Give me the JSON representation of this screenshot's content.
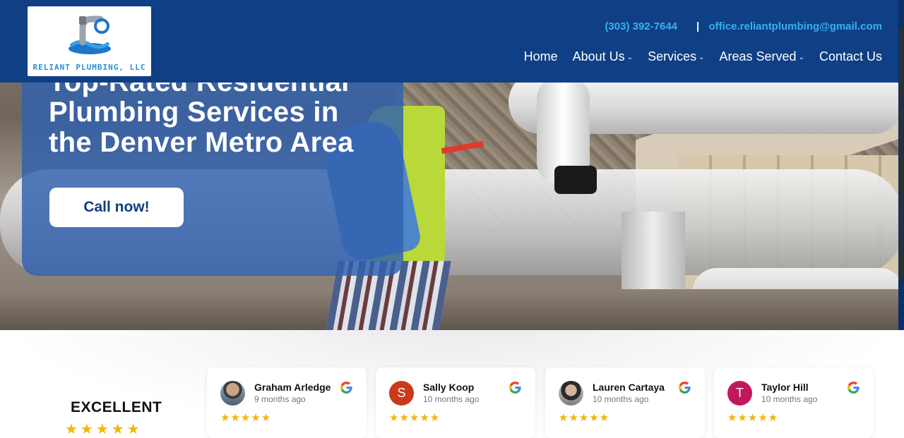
{
  "header": {
    "logo_text": "RELIANT PLUMBING, LLC",
    "phone": "(303) 392-7644",
    "divider": "|",
    "email": "office.reliantplumbing@gmail.com",
    "nav": [
      {
        "label": "Home",
        "dropdown": false
      },
      {
        "label": "About Us",
        "dropdown": true
      },
      {
        "label": "Services",
        "dropdown": true
      },
      {
        "label": "Areas Served",
        "dropdown": true
      },
      {
        "label": "Contact Us",
        "dropdown": false
      }
    ],
    "caret": "⌄"
  },
  "hero": {
    "title": "Top-Rated Residential Plumbing Services in the Denver Metro Area",
    "cta_label": "Call now!"
  },
  "reviews": {
    "summary_label": "EXCELLENT",
    "summary_stars": "★★★★★",
    "items": [
      {
        "name": "Graham Arledge",
        "time": "9 months ago",
        "stars": "★★★★★",
        "avatar": "photo",
        "initial": ""
      },
      {
        "name": "Sally Koop",
        "time": "10 months ago",
        "stars": "★★★★★",
        "avatar": "letter",
        "initial": "S",
        "avatar_color": "#c9391a"
      },
      {
        "name": "Lauren Cartaya",
        "time": "10 months ago",
        "stars": "★★★★★",
        "avatar": "photo2",
        "initial": ""
      },
      {
        "name": "Taylor Hill",
        "time": "10 months ago",
        "stars": "★★★★★",
        "avatar": "letter",
        "initial": "T",
        "avatar_color": "#c2185b"
      }
    ]
  },
  "colors": {
    "header_bg": "#0f3f85",
    "accent_link": "#37b0f0",
    "hero_card": "rgba(47,96,175,.82)",
    "star": "#f4b400"
  }
}
